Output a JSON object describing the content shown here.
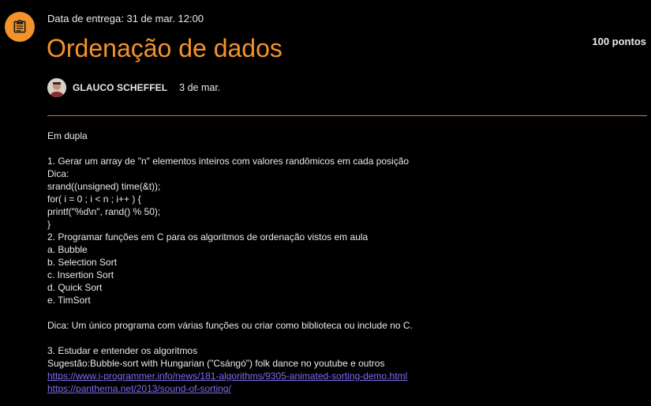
{
  "assignment": {
    "icon": "assignment-icon",
    "due_date": "Data de entrega: 31 de mar. 12:00",
    "title": "Ordenação de dados",
    "points": "100 pontos",
    "author": "GLAUCO SCHEFFEL",
    "posted_date": "3 de mar.",
    "accent_color": "#f4932a"
  },
  "description": {
    "lines": [
      "Em dupla",
      "",
      "1. Gerar um array de \"n\" elementos inteiros com valores randômicos em cada posição",
      "Dica:",
      "srand((unsigned) time(&t));",
      "for( i = 0 ; i < n ; i++ ) {",
      "printf(\"%d\\n\", rand() % 50);",
      "}",
      "2. Programar funções em C para os algoritmos de ordenação vistos em aula",
      "a. Bubble",
      "b. Selection Sort",
      "c. Insertion Sort",
      "d. Quick Sort",
      "e. TimSort",
      "",
      "Dica: Um único programa com várias funções ou criar como biblioteca ou include no C.",
      "",
      "3. Estudar e entender os algoritmos",
      "Sugestão:Bubble-sort with Hungarian (\"Csángó\") folk dance no youtube e outros"
    ],
    "links": [
      "https://www.i-programmer.info/news/181-algorithms/9305-animated-sorting-demo.html",
      "https://panthema.net/2013/sound-of-sorting/"
    ]
  }
}
